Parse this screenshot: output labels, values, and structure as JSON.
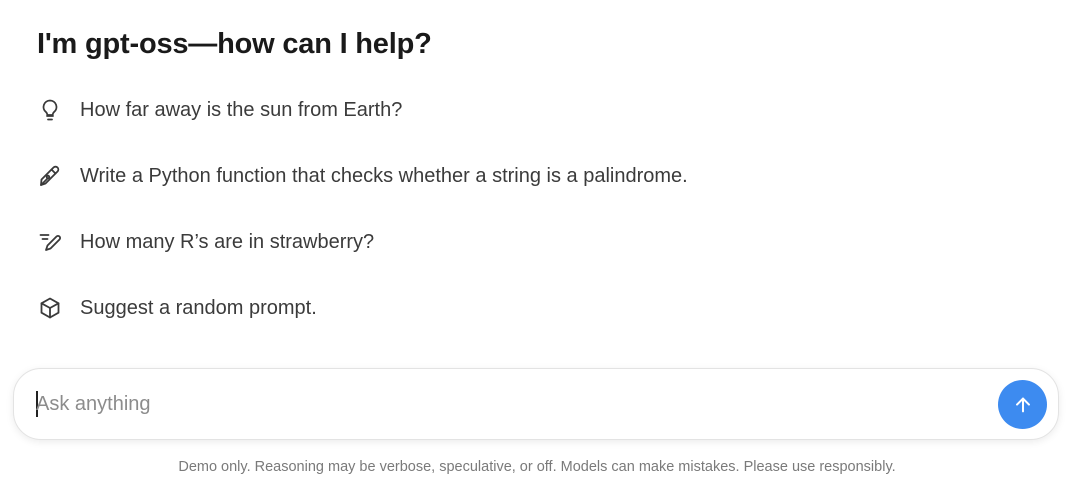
{
  "header": {
    "title": "I'm gpt-oss—how can I help?"
  },
  "suggestions": [
    {
      "icon": "lightbulb-icon",
      "label": "How far away is the sun from Earth?"
    },
    {
      "icon": "pen-nib-icon",
      "label": "Write a Python function that checks whether a string is a palindrome."
    },
    {
      "icon": "pencil-lines-icon",
      "label": "How many R’s are in strawberry?"
    },
    {
      "icon": "cube-icon",
      "label": "Suggest a random prompt."
    }
  ],
  "composer": {
    "placeholder": "Ask anything",
    "value": "",
    "send_icon": "arrow-up-icon",
    "send_color": "#3d8bf0"
  },
  "footer": {
    "disclaimer": "Demo only. Reasoning may be verbose, speculative, or off. Models can make mistakes. Please use responsibly."
  }
}
